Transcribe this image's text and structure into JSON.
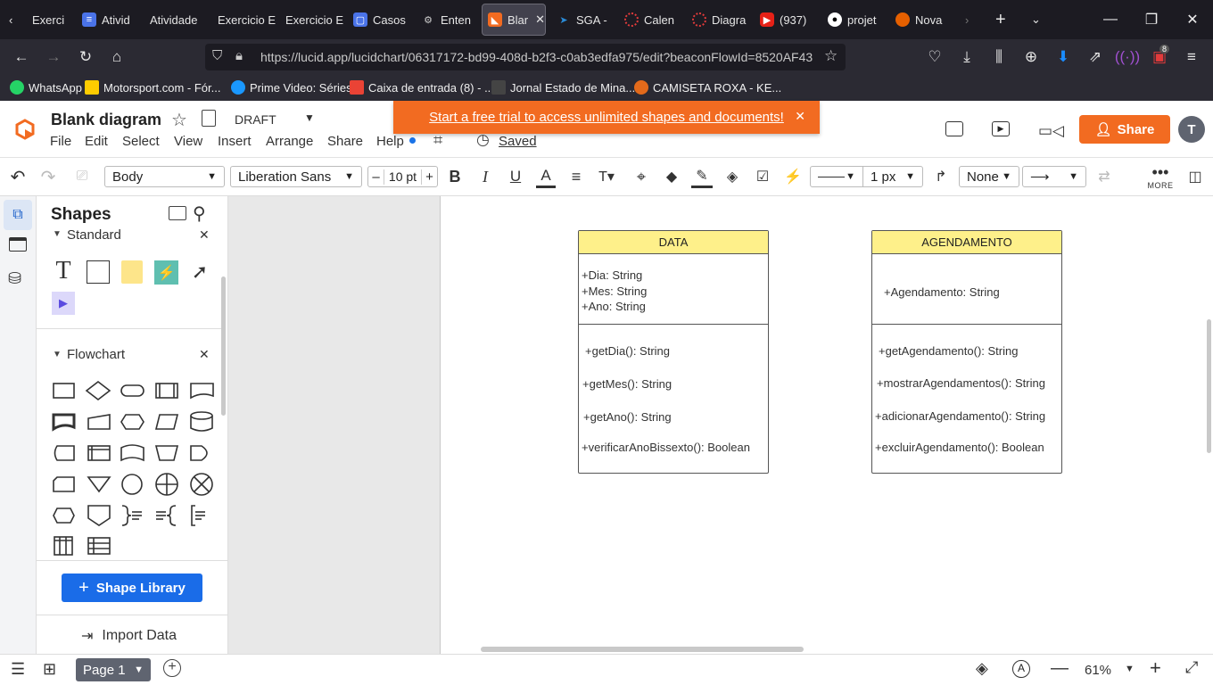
{
  "browser": {
    "tabs": [
      {
        "label": "Exerci",
        "color": "#555"
      },
      {
        "label": "Ativid",
        "color": "#4a73e8"
      },
      {
        "label": "Atividade",
        "color": ""
      },
      {
        "label": "Exercicio E",
        "color": ""
      },
      {
        "label": "Exercicio E",
        "color": ""
      },
      {
        "label": "Casos",
        "color": "#4a73e8"
      },
      {
        "label": "Enten",
        "color": "#888"
      },
      {
        "label": "Blar",
        "color": "#f26b21"
      },
      {
        "label": "SGA -",
        "color": "#2a8cd8"
      },
      {
        "label": "Calen",
        "color": "#e23b3b"
      },
      {
        "label": "Diagra",
        "color": "#e23b3b"
      },
      {
        "label": "(937)",
        "color": "#e62117"
      },
      {
        "label": "projet",
        "color": "#fff"
      },
      {
        "label": "Nova",
        "color": "#e66000"
      }
    ],
    "url": "https://lucid.app/lucidchart/06317172-bd99-408d-b2f3-c0ab3edfa975/edit?beaconFlowId=8520AF43",
    "notification_count": "8",
    "bookmarks": [
      {
        "label": "WhatsApp",
        "color": "#25d366"
      },
      {
        "label": "Motorsport.com - Fór...",
        "color": "#ffcc00"
      },
      {
        "label": "Prime Video: Séries",
        "color": "#1a98ff"
      },
      {
        "label": "Caixa de entrada (8) - ...",
        "color": "#ea4335"
      },
      {
        "label": "Jornal Estado de Mina...",
        "color": "#444"
      },
      {
        "label": "CAMISETA ROXA - KE...",
        "color": "#e36a1b"
      }
    ]
  },
  "app": {
    "title": "Blank diagram",
    "status": "DRAFT",
    "menu": [
      "File",
      "Edit",
      "Select",
      "View",
      "Insert",
      "Arrange",
      "Share",
      "Help"
    ],
    "saved": "Saved",
    "banner": "Start a free trial to access unlimited shapes and documents!",
    "share": "Share",
    "avatar": "T",
    "accent": "#f26b21"
  },
  "toolbar": {
    "style": "Body",
    "font": "Liberation Sans",
    "size": "10 pt",
    "line_width": "1 px",
    "endpoint": "None",
    "more": "MORE"
  },
  "shapes_panel": {
    "title": "Shapes",
    "standard": "Standard",
    "flowchart": "Flowchart",
    "library": "Shape Library",
    "import": "Import Data"
  },
  "diagram": {
    "data_class": {
      "name": "DATA",
      "attributes": [
        "+Dia: String",
        "+Mes: String",
        "+Ano: String"
      ],
      "methods": [
        "+getDia(): String",
        "+getMes(): String",
        "+getAno(): String",
        "+verificarAnoBissexto(): Boolean"
      ]
    },
    "agenda_class": {
      "name": "AGENDAMENTO",
      "attributes": [
        "+Agendamento: String"
      ],
      "methods": [
        "+getAgendamento(): String",
        "+mostrarAgendamentos(): String",
        "+adicionarAgendamento(): String",
        "+excluirAgendamento(): Boolean"
      ]
    }
  },
  "footer": {
    "page": "Page 1",
    "zoom": "61%"
  }
}
